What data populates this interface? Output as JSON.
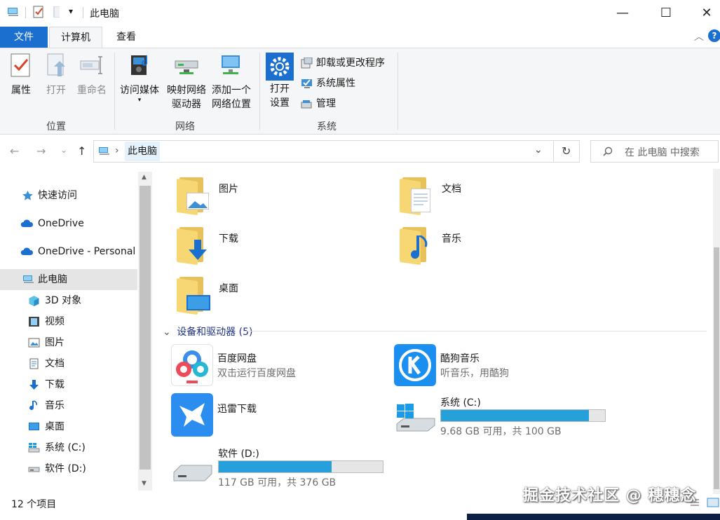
{
  "window": {
    "title": "此电脑",
    "minimize_symbol": "—",
    "maximize_symbol": "☐",
    "close_symbol": "✕",
    "quick_access_dropdown": "▾"
  },
  "ribbon": {
    "tabs": [
      {
        "label": "文件"
      },
      {
        "label": "计算机"
      },
      {
        "label": "查看"
      }
    ],
    "help_symbol": "?",
    "collapse_symbol": "︿",
    "groups": {
      "location": {
        "label": "位置",
        "properties": "属性",
        "open": "打开",
        "rename": "重命名"
      },
      "network": {
        "label": "网络",
        "access_media": "访问媒体",
        "map_drive_line1": "映射网络",
        "map_drive_line2": "驱动器",
        "add_location_line1": "添加一个",
        "add_location_line2": "网络位置"
      },
      "system": {
        "label": "系统",
        "open_settings_line1": "打开",
        "open_settings_line2": "设置",
        "uninstall": "卸载或更改程序",
        "system_properties": "系统属性",
        "manage": "管理"
      }
    }
  },
  "nav": {
    "back": "←",
    "forward": "→",
    "recent": "⌄",
    "up": "↑",
    "address_separator": "›",
    "address_path": "此电脑",
    "address_dropdown": "⌄",
    "refresh": "↻",
    "search_placeholder": "在 此电脑 中搜索"
  },
  "sidebar": {
    "items": [
      {
        "label": "快速访问",
        "icon": "star-icon"
      },
      {
        "label": "OneDrive",
        "icon": "cloud-icon"
      },
      {
        "label": "OneDrive - Personal",
        "icon": "cloud-icon"
      },
      {
        "label": "此电脑",
        "icon": "computer-icon"
      },
      {
        "label": "3D 对象",
        "icon": "cube-icon"
      },
      {
        "label": "视频",
        "icon": "film-icon"
      },
      {
        "label": "图片",
        "icon": "picture-icon"
      },
      {
        "label": "文档",
        "icon": "document-icon"
      },
      {
        "label": "下载",
        "icon": "download-icon"
      },
      {
        "label": "音乐",
        "icon": "music-icon"
      },
      {
        "label": "桌面",
        "icon": "desktop-icon"
      },
      {
        "label": "系统 (C:)",
        "icon": "windows-drive-icon"
      },
      {
        "label": "软件 (D:)",
        "icon": "drive-icon"
      }
    ],
    "scroll_up": "▲",
    "scroll_down": "▼"
  },
  "content": {
    "folders": [
      {
        "label": "图片"
      },
      {
        "label": "文档"
      },
      {
        "label": "下载"
      },
      {
        "label": "音乐"
      },
      {
        "label": "桌面"
      }
    ],
    "devices_section": {
      "toggle": "⌄",
      "label": "设备和驱动器 (5)"
    },
    "devices": [
      {
        "name": "百度网盘",
        "subtitle": "双击运行百度网盘"
      },
      {
        "name": "酷狗音乐",
        "subtitle": "听音乐，用酷狗"
      },
      {
        "name": "迅雷下载"
      },
      {
        "name": "系统 (C:)",
        "subtitle": "9.68 GB 可用，共 100 GB",
        "used_fraction": 0.903
      },
      {
        "name": "软件 (D:)",
        "subtitle": "117 GB 可用，共 376 GB",
        "used_fraction": 0.689
      }
    ]
  },
  "status": {
    "item_count": "12 个项目"
  },
  "watermark": "掘金技术社区 @ 穗穗念",
  "colors": {
    "accent": "#1a6fcf",
    "drive_bar_fill": "#26a0da",
    "section_heading": "#1e3287",
    "folder_yellow": "#f7d774"
  }
}
